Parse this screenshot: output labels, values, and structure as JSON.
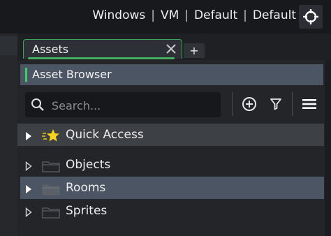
{
  "header": {
    "targets": [
      {
        "label": "Windows"
      },
      {
        "label": "VM"
      },
      {
        "label": "Default"
      },
      {
        "label": "Default"
      }
    ],
    "separator": "|",
    "target_icon": "crosshair-icon"
  },
  "tabs": [
    {
      "label": "Assets",
      "active": true
    }
  ],
  "tab_add_label": "+",
  "tab_close_label": "×",
  "panel": {
    "title": "Asset Browser",
    "search": {
      "placeholder": "Search...",
      "value": ""
    },
    "toolbar_icons": [
      "add-icon",
      "filter-icon",
      "menu-icon"
    ]
  },
  "tree": {
    "quick_access": {
      "label": "Quick Access",
      "icon": "star-icon"
    },
    "items": [
      {
        "label": "Objects",
        "icon": "folder-icon"
      },
      {
        "label": "Rooms",
        "icon": "folder-icon",
        "selected": true
      },
      {
        "label": "Sprites",
        "icon": "folder-icon"
      }
    ]
  },
  "colors": {
    "accent": "#3fcf6a",
    "selection": "#4b5563",
    "background": "#232529"
  }
}
